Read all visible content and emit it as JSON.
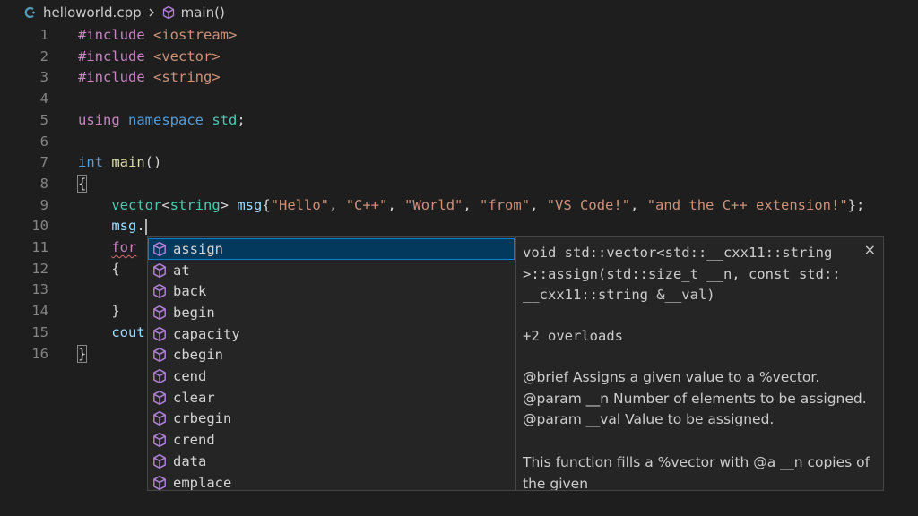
{
  "breadcrumb": {
    "file": "helloworld.cpp",
    "symbol": "main()"
  },
  "editor": {
    "lines": [
      {
        "num": "1",
        "segments": [
          {
            "t": "#include ",
            "c": "kw-pre"
          },
          {
            "t": "<iostream>",
            "c": "str"
          }
        ]
      },
      {
        "num": "2",
        "segments": [
          {
            "t": "#include ",
            "c": "kw-pre"
          },
          {
            "t": "<vector>",
            "c": "str"
          }
        ]
      },
      {
        "num": "3",
        "segments": [
          {
            "t": "#include ",
            "c": "kw-pre"
          },
          {
            "t": "<string>",
            "c": "str"
          }
        ]
      },
      {
        "num": "4",
        "segments": []
      },
      {
        "num": "5",
        "segments": [
          {
            "t": "using ",
            "c": "kw-pre"
          },
          {
            "t": "namespace ",
            "c": "kw"
          },
          {
            "t": "std",
            "c": "ns"
          },
          {
            "t": ";",
            "c": "plain"
          }
        ]
      },
      {
        "num": "6",
        "segments": []
      },
      {
        "num": "7",
        "segments": [
          {
            "t": "int ",
            "c": "kw"
          },
          {
            "t": "main",
            "c": "fn"
          },
          {
            "t": "()",
            "c": "plain"
          }
        ]
      },
      {
        "num": "8",
        "segments": [
          {
            "t": "{",
            "c": "plain bracket-hl"
          }
        ]
      },
      {
        "num": "9",
        "segments": [
          {
            "t": "    vector",
            "c": "ns"
          },
          {
            "t": "<",
            "c": "plain"
          },
          {
            "t": "string",
            "c": "ns"
          },
          {
            "t": "> ",
            "c": "plain"
          },
          {
            "t": "msg",
            "c": "var"
          },
          {
            "t": "{",
            "c": "plain"
          },
          {
            "t": "\"Hello\"",
            "c": "str"
          },
          {
            "t": ", ",
            "c": "plain"
          },
          {
            "t": "\"C++\"",
            "c": "str"
          },
          {
            "t": ", ",
            "c": "plain"
          },
          {
            "t": "\"World\"",
            "c": "str"
          },
          {
            "t": ", ",
            "c": "plain"
          },
          {
            "t": "\"from\"",
            "c": "str"
          },
          {
            "t": ", ",
            "c": "plain"
          },
          {
            "t": "\"VS Code!\"",
            "c": "str"
          },
          {
            "t": ", ",
            "c": "plain"
          },
          {
            "t": "\"and the C++ extension!\"",
            "c": "str"
          },
          {
            "t": "};",
            "c": "plain"
          }
        ]
      },
      {
        "num": "10",
        "segments": [
          {
            "t": "    msg",
            "c": "var"
          },
          {
            "t": ".",
            "c": "plain"
          }
        ],
        "cursor": true
      },
      {
        "num": "11",
        "segments": [
          {
            "t": "    ",
            "c": "plain"
          },
          {
            "t": "for",
            "c": "kw-pre squiggle"
          }
        ]
      },
      {
        "num": "12",
        "segments": [
          {
            "t": "    {",
            "c": "plain"
          }
        ]
      },
      {
        "num": "13",
        "segments": []
      },
      {
        "num": "14",
        "segments": [
          {
            "t": "    }",
            "c": "plain"
          }
        ]
      },
      {
        "num": "15",
        "segments": [
          {
            "t": "    cout",
            "c": "var"
          }
        ]
      },
      {
        "num": "16",
        "segments": [
          {
            "t": "}",
            "c": "plain bracket-hl"
          }
        ]
      }
    ]
  },
  "suggest": {
    "selected_index": 0,
    "items": [
      "assign",
      "at",
      "back",
      "begin",
      "capacity",
      "cbegin",
      "cend",
      "clear",
      "crbegin",
      "crend",
      "data",
      "emplace"
    ]
  },
  "details": {
    "signature": "void std::vector<std::__cxx11::string\n>::assign(std::size_t __n, const std::\n__cxx11::string &__val)",
    "overloads": "+2 overloads",
    "doc_lines": [
      "@brief Assigns a given value to a %vector.",
      "@param __n Number of elements to be assigned.",
      "@param __val Value to be assigned."
    ],
    "doc_para": "This function fills a %vector with @a __n copies of the given",
    "close_label": "×"
  },
  "colors": {
    "background": "#1e1e1e",
    "keyword_purple": "#c586c0",
    "keyword_blue": "#569cd6",
    "string": "#ce9178",
    "type": "#4ec9b0",
    "selection": "#04395e",
    "method_icon": "#b180d7"
  },
  "icons": {
    "file": "cpp-file-icon",
    "symbol": "method-cube-icon",
    "suggestion": "method-cube-icon"
  }
}
